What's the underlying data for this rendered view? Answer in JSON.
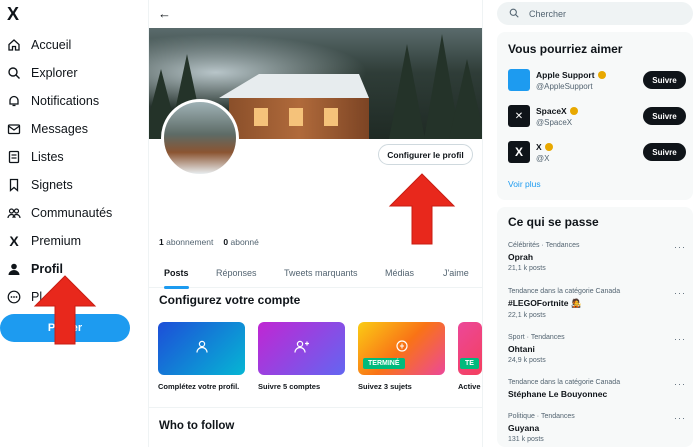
{
  "sidebar": {
    "logo": "X",
    "items": [
      {
        "label": "Accueil",
        "icon": "home-icon"
      },
      {
        "label": "Explorer",
        "icon": "search-icon"
      },
      {
        "label": "Notifications",
        "icon": "bell-icon"
      },
      {
        "label": "Messages",
        "icon": "mail-icon"
      },
      {
        "label": "Listes",
        "icon": "list-icon"
      },
      {
        "label": "Signets",
        "icon": "bookmark-icon"
      },
      {
        "label": "Communautés",
        "icon": "people-icon"
      },
      {
        "label": "Premium",
        "icon": "x-icon"
      },
      {
        "label": "Profil",
        "icon": "person-icon"
      },
      {
        "label": "Pl",
        "icon": "more-icon"
      }
    ],
    "post_label": "Poster"
  },
  "main": {
    "edit_profile_label": "Configurer le profil",
    "following_count": "1",
    "following_label": "abonnement",
    "followers_count": "0",
    "followers_label": "abonné",
    "tabs": [
      "Posts",
      "Réponses",
      "Tweets marquants",
      "Médias",
      "J'aime"
    ],
    "setup_title": "Configurez votre compte",
    "cards": [
      {
        "label": "Complétez votre profil.",
        "badge": ""
      },
      {
        "label": "Suivre 5 comptes",
        "badge": ""
      },
      {
        "label": "Suivez 3 sujets",
        "badge": "TERMINÉ"
      },
      {
        "label": "Active",
        "badge": "TE"
      }
    ],
    "who_to_follow": "Who to follow"
  },
  "right": {
    "search_placeholder": "Chercher",
    "suggest_title": "Vous pourriez aimer",
    "users": [
      {
        "name": "Apple Support",
        "handle": "@AppleSupport",
        "follow": "Suivre"
      },
      {
        "name": "SpaceX",
        "handle": "@SpaceX",
        "follow": "Suivre"
      },
      {
        "name": "X",
        "handle": "@X",
        "follow": "Suivre"
      }
    ],
    "see_more": "Voir plus",
    "trends_title": "Ce qui se passe",
    "trends": [
      {
        "meta": "Célébrités · Tendances",
        "name": "Oprah",
        "posts": "21,1 k posts"
      },
      {
        "meta": "Tendance dans la catégorie Canada",
        "name": "#LEGOFortnite 🧑‍🎤",
        "posts": "22,1 k posts"
      },
      {
        "meta": "Sport · Tendances",
        "name": "Ohtani",
        "posts": "24,9 k posts"
      },
      {
        "meta": "Tendance dans la catégorie Canada",
        "name": "Stéphane Le Bouyonnec",
        "posts": ""
      },
      {
        "meta": "Politique · Tendances",
        "name": "Guyana",
        "posts": "131 k posts"
      }
    ]
  },
  "colors": {
    "accent": "#1d9bf0",
    "arrow": "#e8281c",
    "success": "#00ba7c"
  }
}
